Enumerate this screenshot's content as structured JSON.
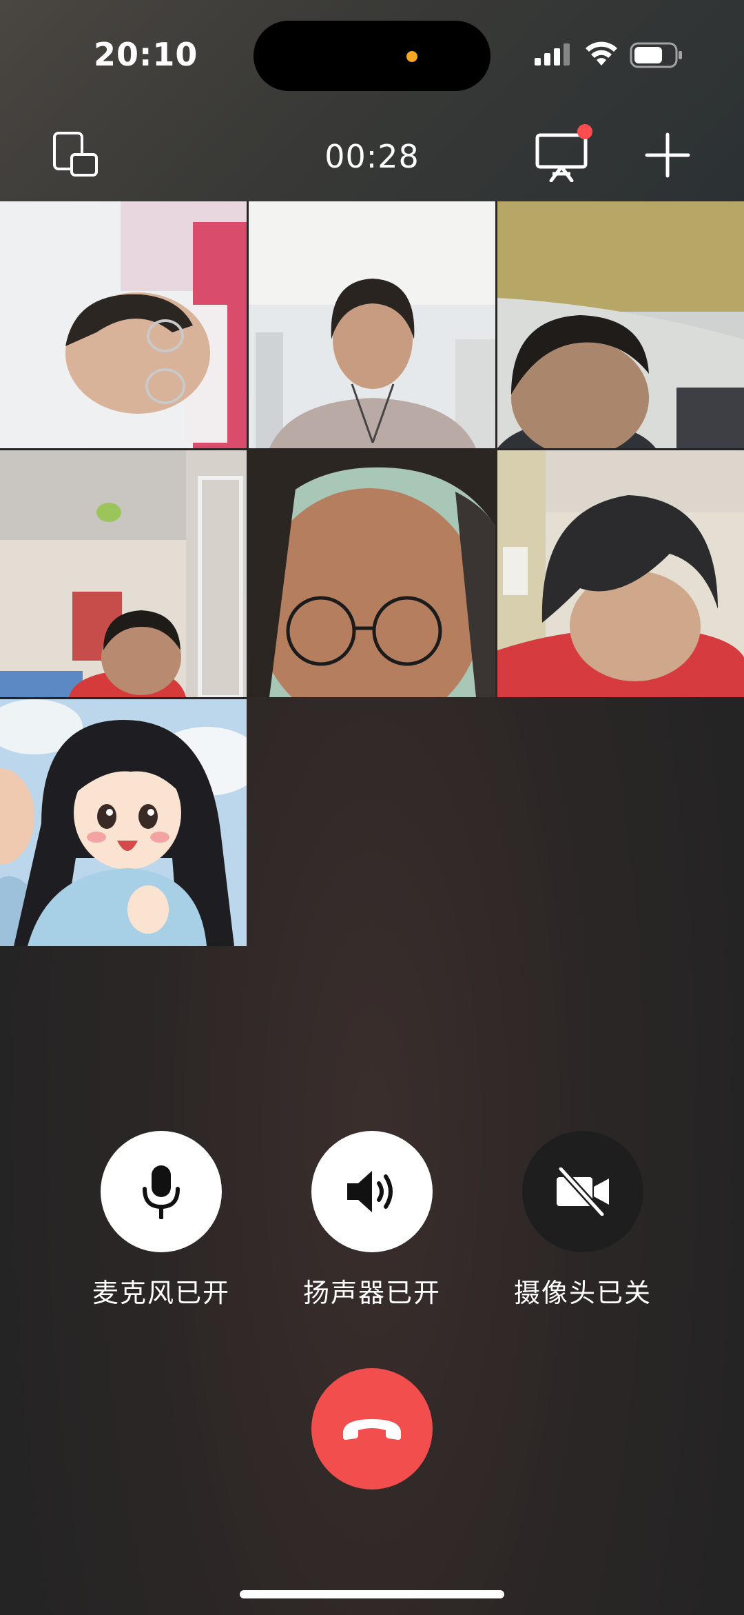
{
  "status_bar": {
    "time": "20:10"
  },
  "call": {
    "timer": "00:28"
  },
  "participants": [
    {
      "id": "participant-1",
      "type": "camera"
    },
    {
      "id": "participant-2",
      "type": "camera"
    },
    {
      "id": "participant-3",
      "type": "camera"
    },
    {
      "id": "participant-4",
      "type": "camera"
    },
    {
      "id": "participant-5",
      "type": "camera"
    },
    {
      "id": "participant-6",
      "type": "camera"
    },
    {
      "id": "participant-7",
      "type": "avatar-cartoon"
    }
  ],
  "controls": {
    "microphone_label": "麦克风已开",
    "speaker_label": "扬声器已开",
    "camera_label": "摄像头已关"
  },
  "icons": {
    "switch_layout": "switch-layout-icon",
    "screen_share": "screen-share-icon",
    "add": "add-icon",
    "microphone": "microphone-icon",
    "speaker": "speaker-icon",
    "camera_off": "camera-off-icon",
    "hangup": "hangup-icon"
  },
  "colors": {
    "hangup": "#f24e4e",
    "notification_dot": "#ff4d4f",
    "island_indicator": "#f5a623"
  }
}
